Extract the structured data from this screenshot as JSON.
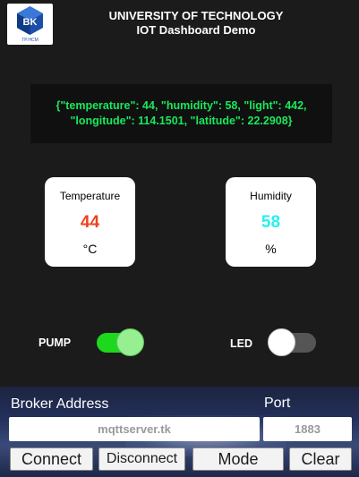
{
  "header": {
    "logo_text": "BK",
    "logo_subtext": "TP.HCM",
    "title_line1": "UNIVERSITY OF TECHNOLOGY",
    "title_line2": "IOT Dashboard Demo"
  },
  "json_message": {
    "line1": "{\"temperature\": 44, \"humidity\": 58, \"light\": 442,",
    "line2": "\"longitude\": 114.1501, \"latitude\": 22.2908}"
  },
  "temperature_card": {
    "label": "Temperature",
    "value": "44",
    "unit": "°C",
    "value_color": "#f0401e"
  },
  "humidity_card": {
    "label": "Humidity",
    "value": "58",
    "unit": "%",
    "value_color": "#25f0ee"
  },
  "toggles": {
    "pump": {
      "label": "PUMP",
      "on": true
    },
    "led": {
      "label": "LED",
      "on": false
    }
  },
  "connection": {
    "broker_label": "Broker Address",
    "broker_value": "mqttserver.tk",
    "port_label": "Port",
    "port_value": "1883"
  },
  "buttons": {
    "connect": "Connect",
    "disconnect": "Disconnect",
    "mode": "Mode",
    "clear": "Clear"
  },
  "colors": {
    "background": "#1b1b1b",
    "json_text": "#19e85c",
    "toggle_on": "#1ed81e",
    "toggle_off": "#555555"
  }
}
